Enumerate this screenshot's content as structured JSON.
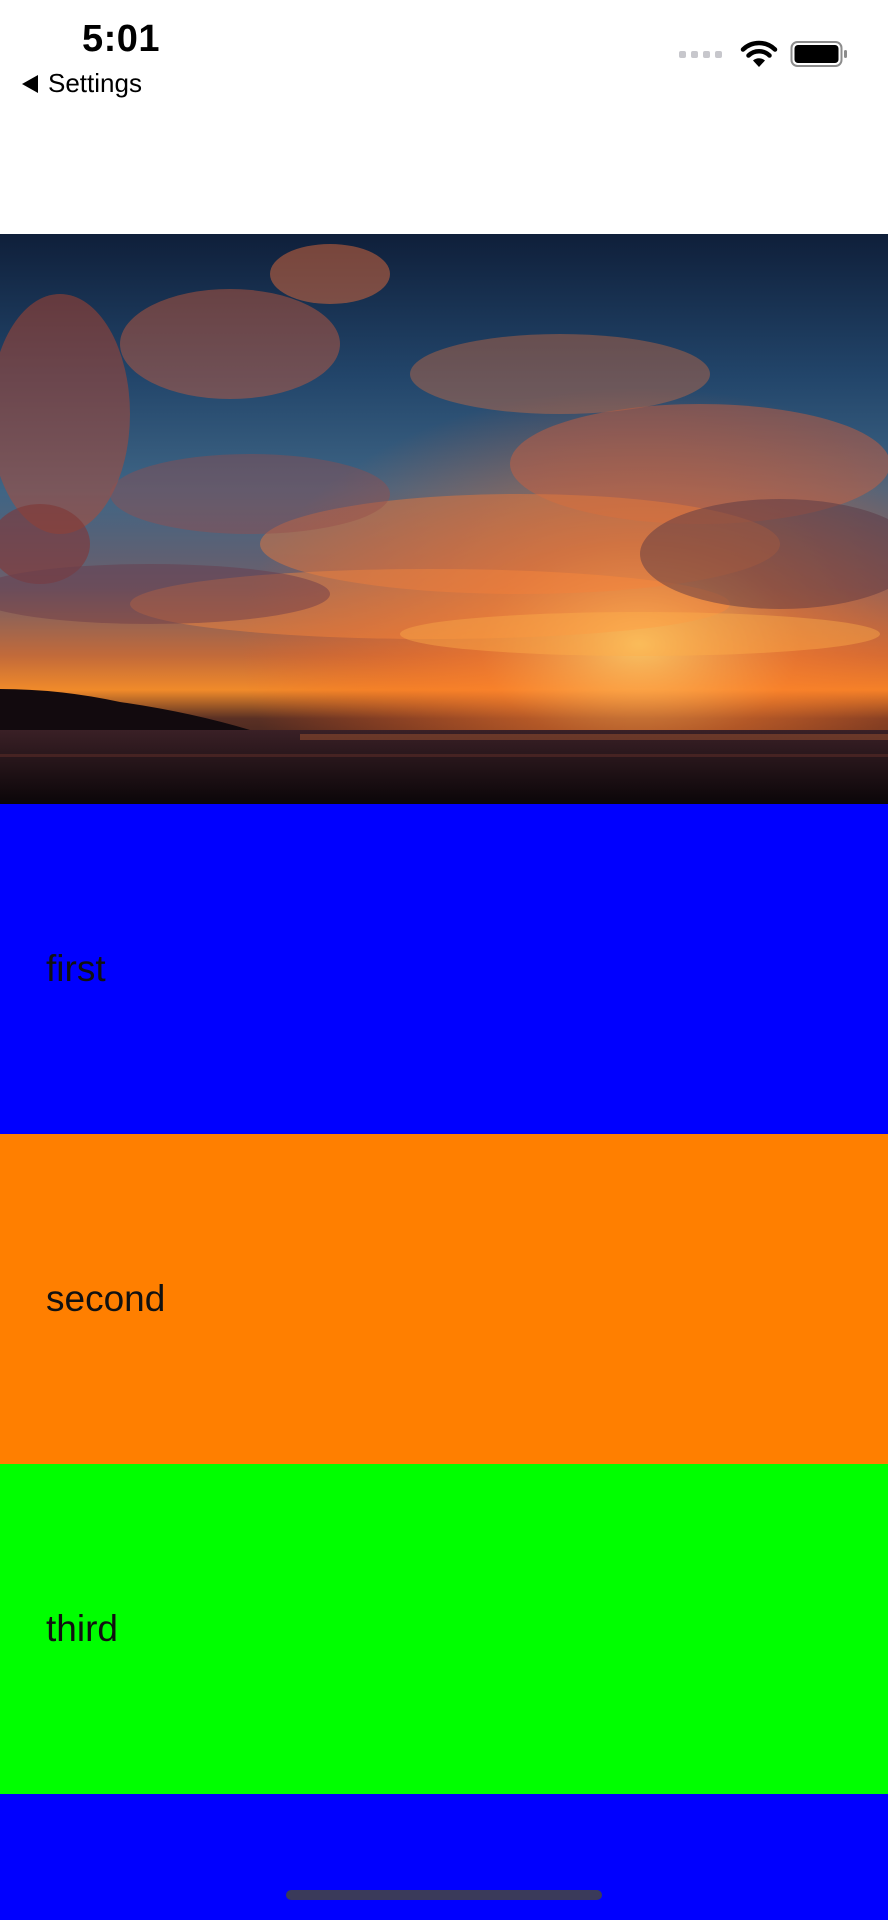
{
  "status_bar": {
    "time": "5:01",
    "back_label": "Settings",
    "icons": [
      "signal-dots-icon",
      "wifi-icon",
      "battery-icon"
    ]
  },
  "header_image": {
    "description_icon": "sunset-photo"
  },
  "rows": [
    {
      "label": "first",
      "color": "#0000ff"
    },
    {
      "label": "second",
      "color": "#ff7f00"
    },
    {
      "label": "third",
      "color": "#00ff00"
    },
    {
      "label": "",
      "color": "#0000ff"
    }
  ]
}
